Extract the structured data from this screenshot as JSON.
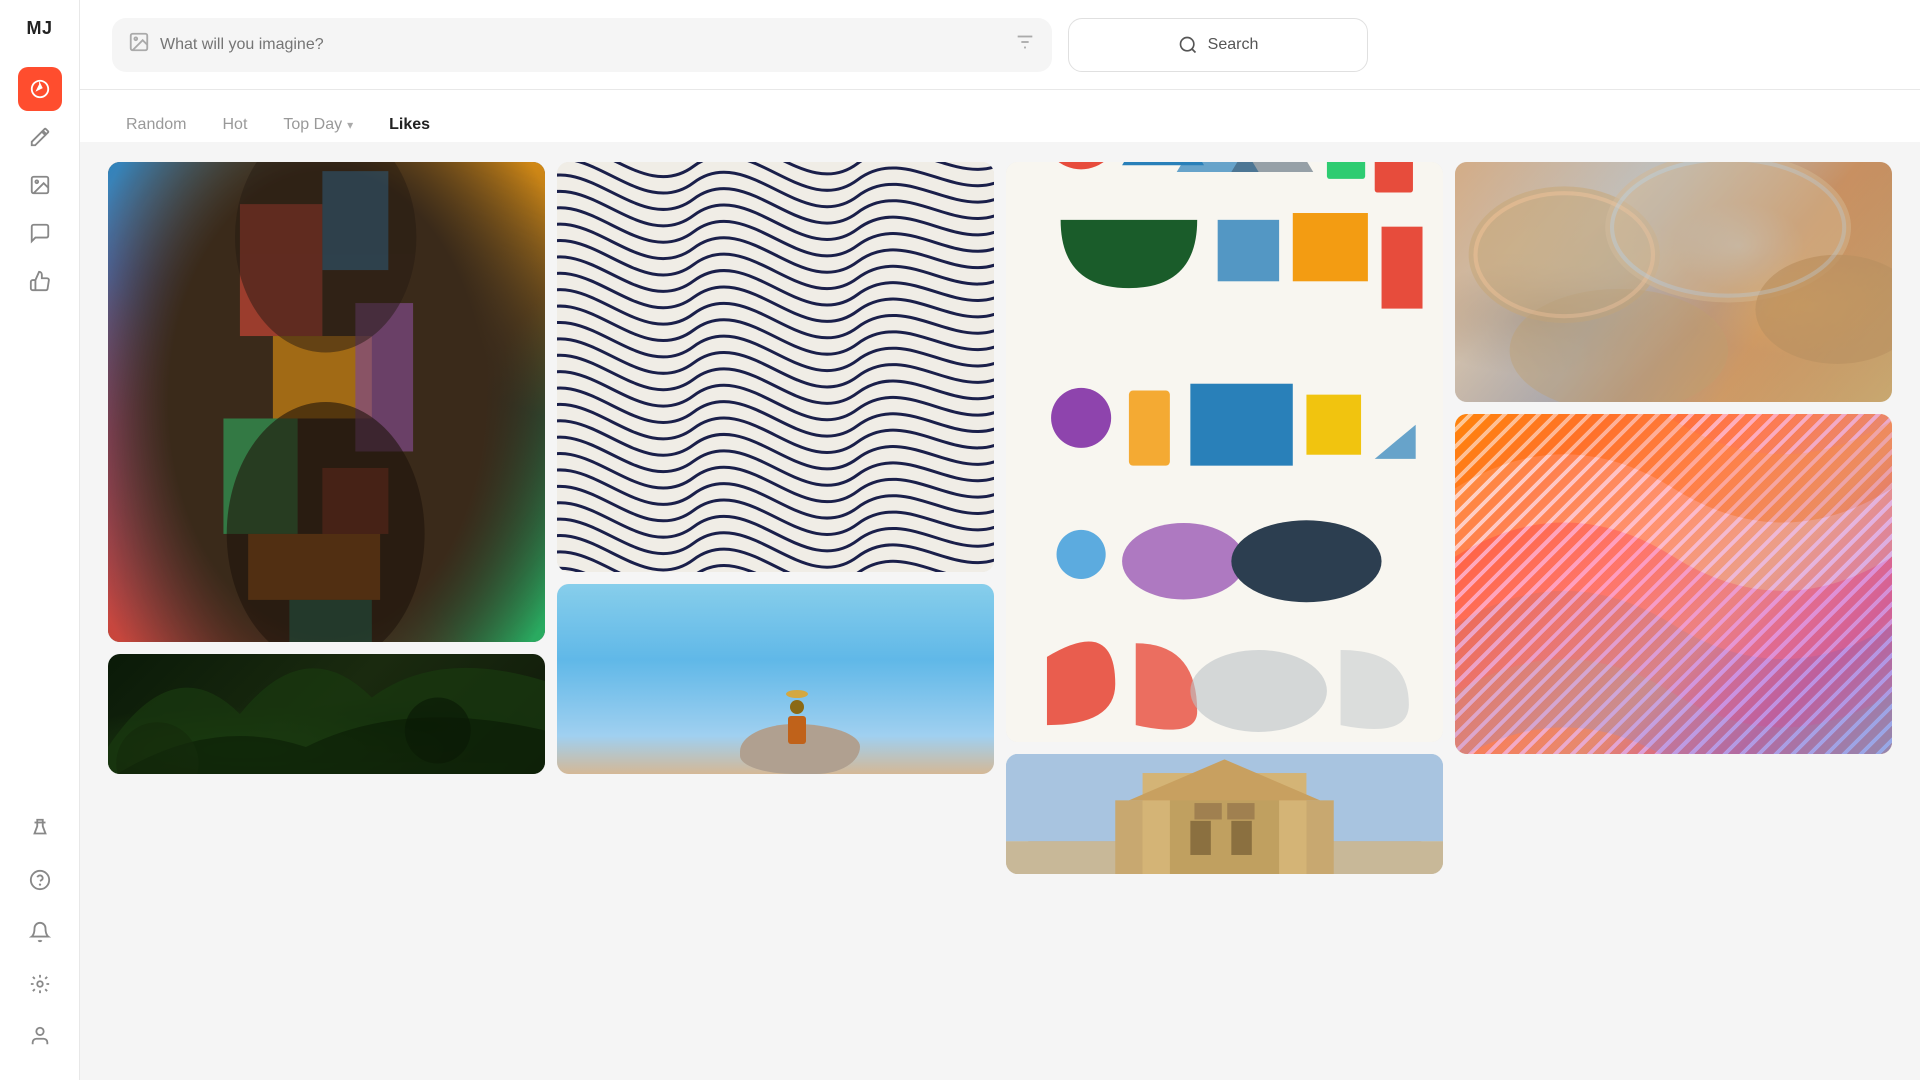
{
  "app": {
    "logo": "MJ"
  },
  "sidebar": {
    "items": [
      {
        "name": "explore-icon",
        "label": "Explore",
        "icon": "compass",
        "active": true
      },
      {
        "name": "brush-icon",
        "label": "Create",
        "icon": "brush",
        "active": false
      },
      {
        "name": "image-icon",
        "label": "Images",
        "icon": "image",
        "active": false
      },
      {
        "name": "chat-icon",
        "label": "Chat",
        "icon": "chat",
        "active": false
      },
      {
        "name": "like-icon",
        "label": "Likes",
        "icon": "thumbup",
        "active": false
      }
    ],
    "bottom_items": [
      {
        "name": "lab-icon",
        "label": "Lab",
        "icon": "lab"
      },
      {
        "name": "help-icon",
        "label": "Help",
        "icon": "help"
      },
      {
        "name": "bell-icon",
        "label": "Notifications",
        "icon": "bell"
      },
      {
        "name": "settings-icon",
        "label": "Settings",
        "icon": "settings"
      },
      {
        "name": "profile-icon",
        "label": "Profile",
        "icon": "profile"
      }
    ]
  },
  "header": {
    "search_placeholder": "What will you imagine?",
    "search_button_label": "Search",
    "filter_icon": "sliders"
  },
  "tabs": [
    {
      "label": "Random",
      "active": false
    },
    {
      "label": "Hot",
      "active": false
    },
    {
      "label": "Top Day",
      "active": false,
      "has_chevron": true
    },
    {
      "label": "Likes",
      "active": true
    }
  ],
  "gallery": {
    "columns": 4
  }
}
